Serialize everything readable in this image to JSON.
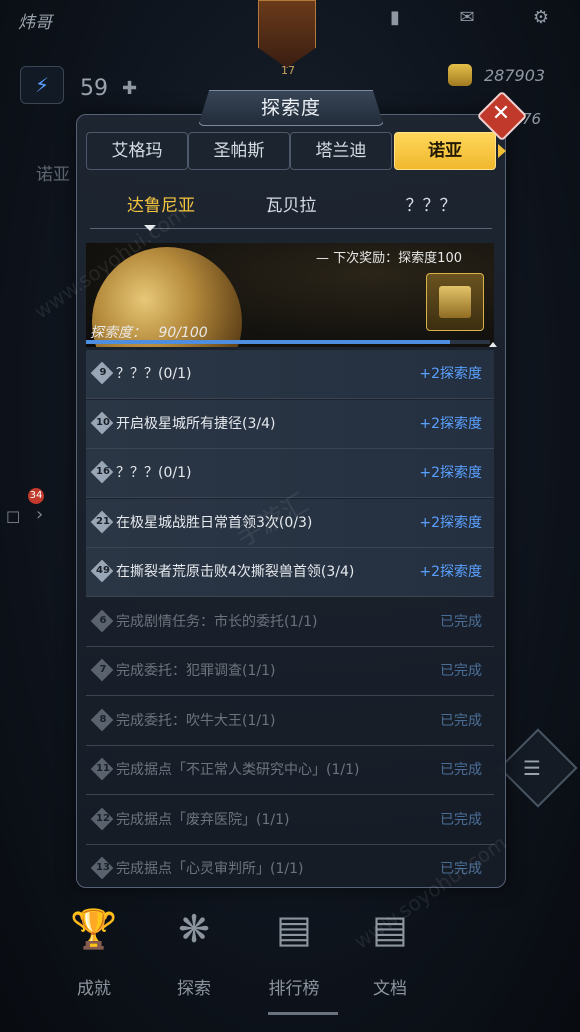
{
  "hud": {
    "player_name": "炜哥",
    "avatar_level": "17",
    "energy": "59",
    "coins": "287903",
    "gems": "76",
    "bg_label": "诺亚",
    "side_badge": "34"
  },
  "modal": {
    "title": "探索度",
    "region_tabs": [
      {
        "label": "艾格玛",
        "active": false
      },
      {
        "label": "圣帕斯",
        "active": false
      },
      {
        "label": "塔兰迪",
        "active": false
      },
      {
        "label": "诺亚",
        "active": true
      }
    ],
    "sub_tabs": [
      {
        "label": "达鲁尼亚",
        "active": true
      },
      {
        "label": "瓦贝拉",
        "active": false
      },
      {
        "label": "？？？",
        "active": false
      }
    ],
    "next_reward": "— 下次奖励：探索度100",
    "explore_label": "探索度：",
    "explore_value": "90/100",
    "explore_progress": 0.9,
    "tasks": [
      {
        "num": "9",
        "text": "？？？(0/1)",
        "reward": "+2探索度",
        "done": false
      },
      {
        "num": "10",
        "text": "开启极星城所有捷径(3/4)",
        "reward": "+2探索度",
        "done": false
      },
      {
        "num": "16",
        "text": "？？？(0/1)",
        "reward": "+2探索度",
        "done": false
      },
      {
        "num": "21",
        "text": "在极星城战胜日常首领3次(0/3)",
        "reward": "+2探索度",
        "done": false
      },
      {
        "num": "49",
        "text": "在撕裂者荒原击败4次撕裂兽首领(3/4)",
        "reward": "+2探索度",
        "done": false
      },
      {
        "num": "6",
        "text": "完成剧情任务：市长的委托(1/1)",
        "reward": "已完成",
        "done": true
      },
      {
        "num": "7",
        "text": "完成委托：犯罪调查(1/1)",
        "reward": "已完成",
        "done": true
      },
      {
        "num": "8",
        "text": "完成委托：吹牛大王(1/1)",
        "reward": "已完成",
        "done": true
      },
      {
        "num": "11",
        "text": "完成据点「不正常人类研究中心」(1/1)",
        "reward": "已完成",
        "done": true
      },
      {
        "num": "12",
        "text": "完成据点「废弃医院」(1/1)",
        "reward": "已完成",
        "done": true
      },
      {
        "num": "13",
        "text": "完成据点「心灵审判所」(1/1)",
        "reward": "已完成",
        "done": true
      }
    ]
  },
  "bottom_nav": [
    {
      "label": "成就",
      "icon": "trophy-icon"
    },
    {
      "label": "探索",
      "icon": "compass-icon"
    },
    {
      "label": "排行榜",
      "icon": "podium-icon"
    },
    {
      "label": "文档",
      "icon": "document-icon"
    }
  ],
  "watermarks": [
    "www.soyohui.com",
    "手游汇",
    "www.soyohui.com"
  ]
}
